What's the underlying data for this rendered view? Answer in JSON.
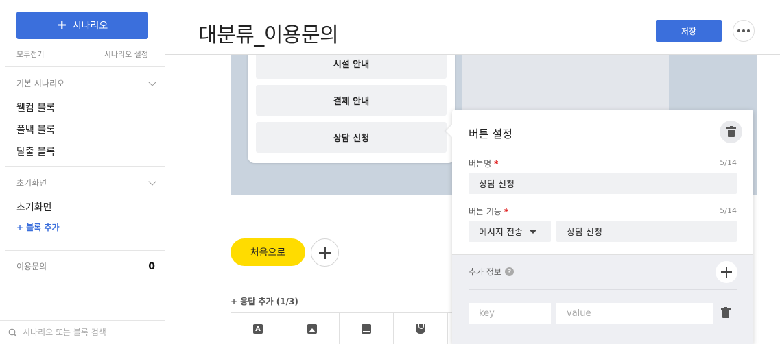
{
  "sidebar": {
    "add_scenario_label": "시나리오",
    "collapse_all": "모두접기",
    "scenario_settings": "시나리오 설정",
    "groups": [
      {
        "title": "기본 시나리오",
        "items": [
          "웰컴 블록",
          "폴백 블록",
          "탈출 블록"
        ]
      },
      {
        "title": "초기화면",
        "items": [
          "초기화면"
        ],
        "add_block": "+ 블록 추가"
      }
    ],
    "inquiry": {
      "label": "이용문의",
      "count": "0"
    },
    "search_placeholder": "시나리오 또는 블록 검색"
  },
  "header": {
    "title": "대분류_이용문의",
    "save_label": "저장"
  },
  "preview": {
    "buttons": [
      "시설 안내",
      "결제 안내",
      "상담 신청"
    ]
  },
  "main": {
    "home_button": "처음으로",
    "add_response": "+ 응답 추가 (1/3)"
  },
  "button_settings": {
    "title": "버튼 설정",
    "name_label": "버튼명",
    "name_count": "5/14",
    "name_value": "상담 신청",
    "function_label": "버튼 기능",
    "function_count": "5/14",
    "function_type": "메시지 전송",
    "function_value": "상담 신청",
    "extra_info_label": "추가 정보",
    "key_placeholder": "key",
    "value_placeholder": "value"
  },
  "colors": {
    "accent": "#3b6fdc",
    "home_button": "#ffdc00",
    "required": "#e01c1c"
  }
}
